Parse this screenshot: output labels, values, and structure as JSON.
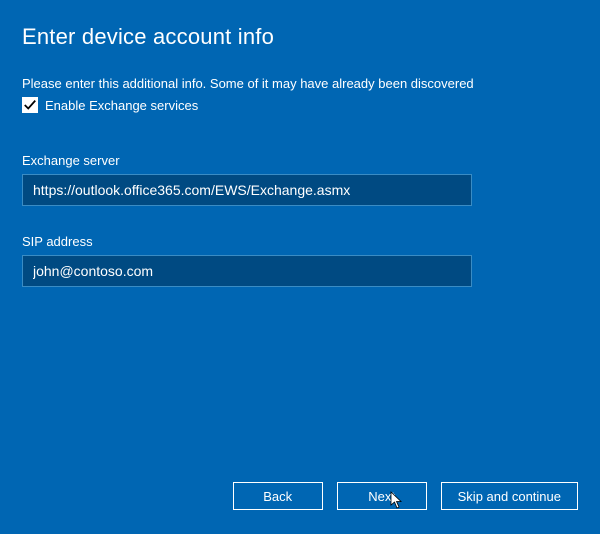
{
  "title": "Enter device account info",
  "instruction": "Please enter this additional info. Some of it may have already been discovered",
  "checkbox": {
    "checked": true,
    "label": "Enable Exchange services"
  },
  "fields": {
    "exchange_server": {
      "label": "Exchange server",
      "value": "https://outlook.office365.com/EWS/Exchange.asmx",
      "placeholder": ""
    },
    "sip_address": {
      "label": "SIP address",
      "value": "john@contoso.com",
      "placeholder": ""
    }
  },
  "buttons": {
    "back": "Back",
    "next": "Next",
    "skip": "Skip and continue"
  },
  "colors": {
    "background": "#0066b3",
    "input_bg": "#004a82",
    "border": "#3a8cc4",
    "text": "#ffffff"
  }
}
